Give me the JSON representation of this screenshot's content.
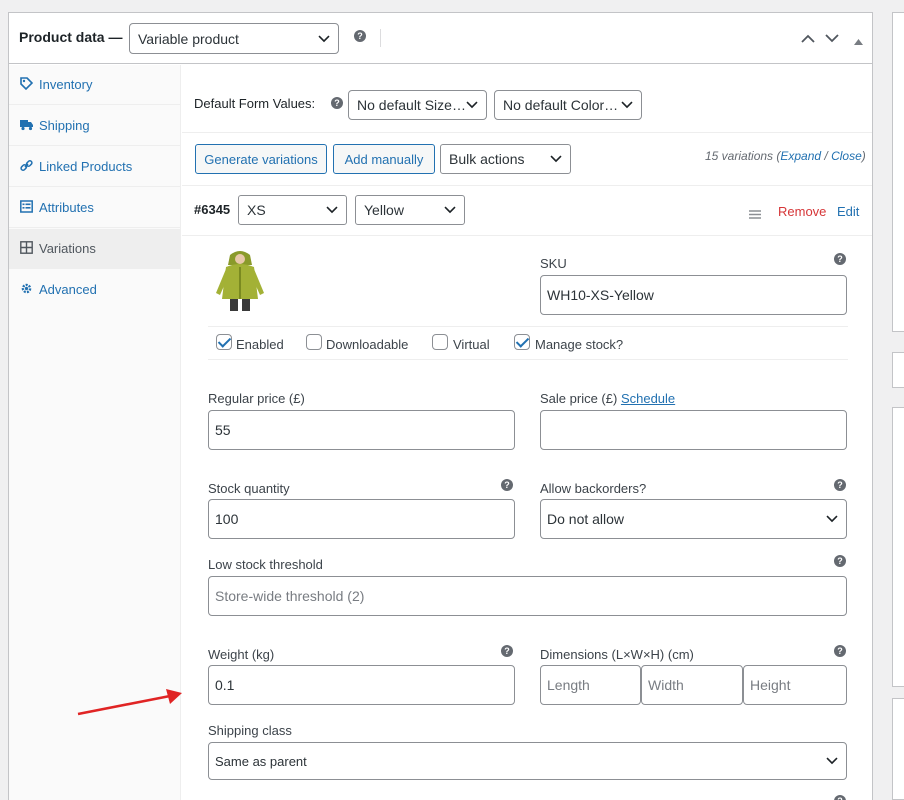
{
  "header": {
    "title": "Product data —",
    "product_type": "Variable product",
    "help_glyph": "?"
  },
  "tabs": [
    {
      "label": "Inventory",
      "icon": "tag-icon"
    },
    {
      "label": "Shipping",
      "icon": "truck-icon"
    },
    {
      "label": "Linked Products",
      "icon": "link-icon"
    },
    {
      "label": "Attributes",
      "icon": "list-icon"
    },
    {
      "label": "Variations",
      "icon": "grid-icon",
      "active": true
    },
    {
      "label": "Advanced",
      "icon": "gear-icon"
    }
  ],
  "defaults": {
    "label": "Default Form Values:",
    "size": "No default Size…",
    "color": "No default Color…"
  },
  "toolbar": {
    "generate": "Generate variations",
    "add_manually": "Add manually",
    "bulk_actions": "Bulk actions",
    "count_text": "15 variations (",
    "expand": "Expand",
    "slash": " / ",
    "close": "Close",
    "close_paren": ")"
  },
  "variation": {
    "id": "#6345",
    "size": "XS",
    "color": "Yellow",
    "remove": "Remove",
    "edit": "Edit",
    "image_alt": "yellow hoodie product image"
  },
  "fields": {
    "sku_label": "SKU",
    "sku_value": "WH10-XS-Yellow",
    "enabled": "Enabled",
    "downloadable": "Downloadable",
    "virtual": "Virtual",
    "manage_stock": "Manage stock?",
    "regular_price_label": "Regular price (£)",
    "regular_price": "55",
    "sale_price_label": "Sale price (£)",
    "schedule": "Schedule",
    "sale_price": "",
    "stock_qty_label": "Stock quantity",
    "stock_qty": "100",
    "backorders_label": "Allow backorders?",
    "backorders": "Do not allow",
    "low_stock_label": "Low stock threshold",
    "low_stock_placeholder": "Store-wide threshold (2)",
    "weight_label": "Weight (kg)",
    "weight": "0.1",
    "dimensions_label": "Dimensions (L×W×H) (cm)",
    "length_ph": "Length",
    "width_ph": "Width",
    "height_ph": "Height",
    "shipping_class_label": "Shipping class",
    "shipping_class": "Same as parent"
  },
  "checkboxes": {
    "enabled": true,
    "downloadable": false,
    "virtual": false,
    "manage_stock": true
  },
  "colors": {
    "link": "#2271b1",
    "remove": "#d63638",
    "annotation_arrow": "#e02424"
  }
}
